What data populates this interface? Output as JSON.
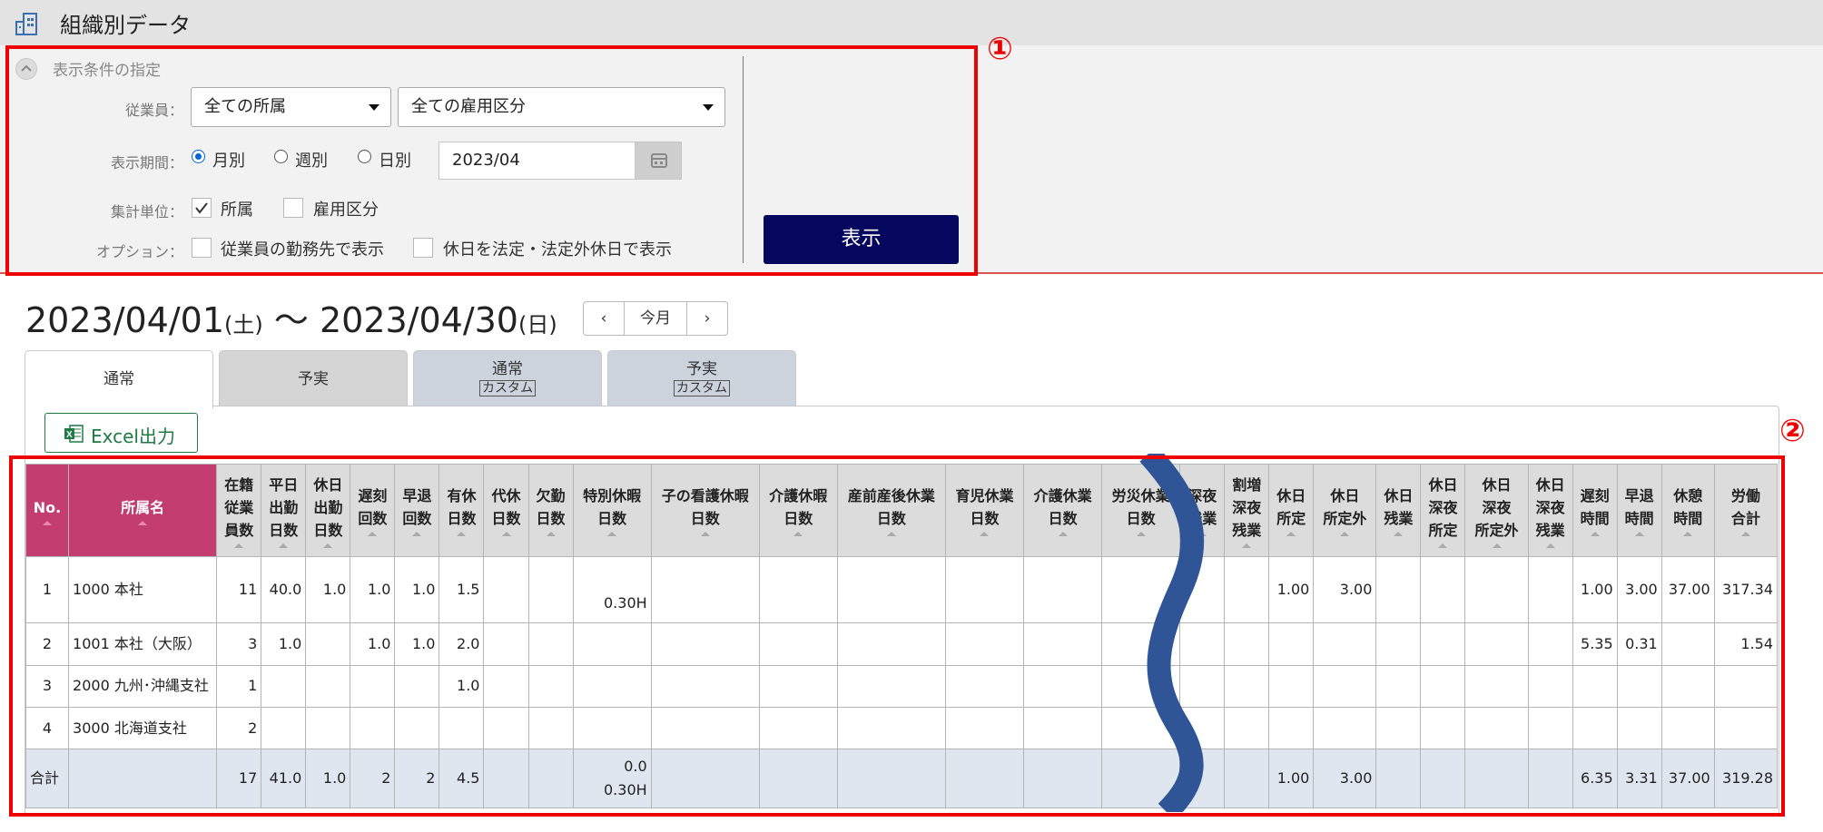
{
  "page": {
    "title": "組織別データ"
  },
  "conditions": {
    "heading": "表示条件の指定",
    "employee_label": "従業員：",
    "employee_affiliation": "全ての所属",
    "employee_type": "全ての雇用区分",
    "period_label": "表示期間：",
    "period_options": [
      "月別",
      "週別",
      "日別"
    ],
    "period_selected": "月別",
    "date_value": "2023/04",
    "unit_label": "集計単位：",
    "unit_options": [
      {
        "label": "所属",
        "checked": true
      },
      {
        "label": "雇用区分",
        "checked": false
      }
    ],
    "option_label": "オプション：",
    "options": [
      {
        "label": "従業員の勤務先で表示",
        "checked": false
      },
      {
        "label": "休日を法定・法定外休日で表示",
        "checked": false
      }
    ],
    "show_button": "表示"
  },
  "callouts": [
    "①",
    "②"
  ],
  "range": {
    "start_date": "2023/04/01",
    "start_day": "(土)",
    "separator": "〜",
    "end_date": "2023/04/30",
    "end_day": "(日)",
    "prev": "‹",
    "current": "今月",
    "next": "›"
  },
  "tabs": [
    {
      "label": "通常",
      "sub": ""
    },
    {
      "label": "予実",
      "sub": ""
    },
    {
      "label": "通常",
      "sub": "カスタム"
    },
    {
      "label": "予実",
      "sub": "カスタム"
    }
  ],
  "excel_button": "Excel出力",
  "table": {
    "headers": [
      [
        "No."
      ],
      [
        "所属名"
      ],
      [
        "在籍",
        "従業",
        "員数"
      ],
      [
        "平日",
        "出勤",
        "日数"
      ],
      [
        "休日",
        "出勤",
        "日数"
      ],
      [
        "遅刻",
        "回数"
      ],
      [
        "早退",
        "回数"
      ],
      [
        "有休",
        "日数"
      ],
      [
        "代休",
        "日数"
      ],
      [
        "欠勤",
        "日数"
      ],
      [
        "特別休暇",
        "日数"
      ],
      [
        "子の看護休暇",
        "日数"
      ],
      [
        "介護休暇",
        "日数"
      ],
      [
        "産前産後休業",
        "日数"
      ],
      [
        "育児休業",
        "日数"
      ],
      [
        "介護休業",
        "日数"
      ],
      [
        "労災休業",
        "日数"
      ],
      [
        "深夜",
        "残業"
      ],
      [
        "割増",
        "深夜",
        "残業"
      ],
      [
        "休日",
        "所定"
      ],
      [
        "休日",
        "所定外"
      ],
      [
        "休日",
        "残業"
      ],
      [
        "休日",
        "深夜",
        "所定"
      ],
      [
        "休日",
        "深夜",
        "所定外"
      ],
      [
        "休日",
        "深夜",
        "残業"
      ],
      [
        "遅刻",
        "時間"
      ],
      [
        "早退",
        "時間"
      ],
      [
        "休憩",
        "時間"
      ],
      [
        "労働",
        "合計"
      ]
    ],
    "rows": [
      {
        "no": "1",
        "name": "1000 本社",
        "cells": [
          "11",
          "40.0",
          "1.0",
          "1.0",
          "1.0",
          "1.5",
          "",
          "",
          "0.30H",
          "",
          "",
          "",
          "",
          "",
          "",
          "",
          "",
          "1.00",
          "3.00",
          "",
          "",
          "",
          "",
          "1.00",
          "3.00",
          "37.00",
          "317.34"
        ]
      },
      {
        "no": "2",
        "name": "1001 本社（大阪）",
        "cells": [
          "3",
          "1.0",
          "",
          "1.0",
          "1.0",
          "2.0",
          "",
          "",
          "",
          "",
          "",
          "",
          "",
          "",
          "",
          "",
          "",
          "",
          "",
          "",
          "",
          "",
          "",
          "5.35",
          "0.31",
          "",
          "1.54"
        ]
      },
      {
        "no": "3",
        "name": "2000 九州･沖縄支社",
        "cells": [
          "1",
          "",
          "",
          "",
          "",
          "1.0",
          "",
          "",
          "",
          "",
          "",
          "",
          "",
          "",
          "",
          "",
          "",
          "",
          "",
          "",
          "",
          "",
          "",
          "",
          "",
          "",
          ""
        ]
      },
      {
        "no": "4",
        "name": "3000 北海道支社",
        "cells": [
          "2",
          "",
          "",
          "",
          "",
          "",
          "",
          "",
          "",
          "",
          "",
          "",
          "",
          "",
          "",
          "",
          "",
          "",
          "",
          "",
          "",
          "",
          "",
          "",
          "",
          "",
          ""
        ]
      }
    ],
    "total": {
      "label": "合計",
      "cells": [
        "17",
        "41.0",
        "1.0",
        "2",
        "2",
        "4.5",
        "",
        "",
        "0.0",
        "",
        "",
        "",
        "",
        "",
        "",
        "",
        "",
        "1.00",
        "3.00",
        "",
        "",
        "",
        "",
        "6.35",
        "3.31",
        "37.00",
        "319.28"
      ],
      "special_second_line": "0.30H"
    }
  },
  "colors": {
    "header_pink": "#c33d70",
    "button_navy": "#05065e",
    "callout_red": "#ee0000",
    "wave_blue": "#2f5597",
    "excel_green": "#1f7a45"
  },
  "icons": [
    "building-icon",
    "collapse-icon",
    "caret-down-icon",
    "calendar-icon",
    "excel-icon"
  ]
}
